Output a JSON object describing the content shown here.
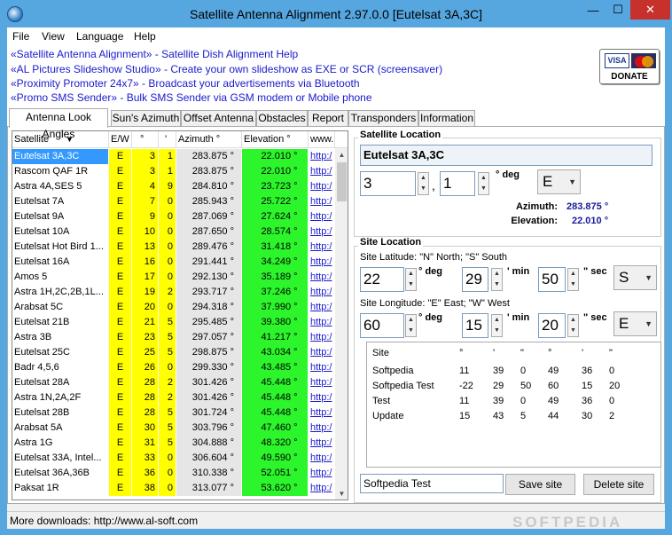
{
  "window": {
    "title": "Satellite Antenna Alignment 2.97.0.0 [Eutelsat 3A,3C]",
    "min_label": "—",
    "max_label": "☐",
    "close_label": "✕"
  },
  "menu": [
    "File",
    "View",
    "Language",
    "Help"
  ],
  "promo_links": [
    "«Satellite Antenna Alignment» - Satellite Dish Alignment Help",
    "«AL Pictures Slideshow Studio» - Create your own slideshow as EXE or SCR (screensaver)",
    "«Proximity Promoter 24x7» - Broadcast your advertisements via Bluetooth",
    "«Promo SMS Sender» - Bulk SMS Sender via GSM modem or Mobile phone"
  ],
  "donate": {
    "label": "DONATE",
    "visa": "VISA"
  },
  "tabs": [
    "Antenna Look Angles",
    "Sun's Azimuth",
    "Offset Antenna",
    "Obstacles",
    "Report",
    "Transponders",
    "Information"
  ],
  "grid": {
    "headers": [
      "Satellite",
      "E/W",
      "°",
      "'",
      "Azimuth °",
      "Elevation °",
      "www."
    ],
    "rows": [
      {
        "name": "Eutelsat 3A,3C",
        "ew": "E",
        "deg": "3",
        "min": "1",
        "az": "283.875 °",
        "el": "22.010 °",
        "url": "http:/"
      },
      {
        "name": "Rascom QAF 1R",
        "ew": "E",
        "deg": "3",
        "min": "1",
        "az": "283.875 °",
        "el": "22.010 °",
        "url": "http:/"
      },
      {
        "name": "Astra 4A,SES 5",
        "ew": "E",
        "deg": "4",
        "min": "9",
        "az": "284.810 °",
        "el": "23.723 °",
        "url": "http:/"
      },
      {
        "name": "Eutelsat 7A",
        "ew": "E",
        "deg": "7",
        "min": "0",
        "az": "285.943 °",
        "el": "25.722 °",
        "url": "http:/"
      },
      {
        "name": "Eutelsat 9A",
        "ew": "E",
        "deg": "9",
        "min": "0",
        "az": "287.069 °",
        "el": "27.624 °",
        "url": "http:/"
      },
      {
        "name": "Eutelsat 10A",
        "ew": "E",
        "deg": "10",
        "min": "0",
        "az": "287.650 °",
        "el": "28.574 °",
        "url": "http:/"
      },
      {
        "name": "Eutelsat Hot Bird 1...",
        "ew": "E",
        "deg": "13",
        "min": "0",
        "az": "289.476 °",
        "el": "31.418 °",
        "url": "http:/"
      },
      {
        "name": "Eutelsat 16A",
        "ew": "E",
        "deg": "16",
        "min": "0",
        "az": "291.441 °",
        "el": "34.249 °",
        "url": "http:/"
      },
      {
        "name": "Amos 5",
        "ew": "E",
        "deg": "17",
        "min": "0",
        "az": "292.130 °",
        "el": "35.189 °",
        "url": "http:/"
      },
      {
        "name": "Astra 1H,2C,2B,1L...",
        "ew": "E",
        "deg": "19",
        "min": "2",
        "az": "293.717 °",
        "el": "37.246 °",
        "url": "http:/"
      },
      {
        "name": "Arabsat 5C",
        "ew": "E",
        "deg": "20",
        "min": "0",
        "az": "294.318 °",
        "el": "37.990 °",
        "url": "http:/"
      },
      {
        "name": "Eutelsat 21B",
        "ew": "E",
        "deg": "21",
        "min": "5",
        "az": "295.485 °",
        "el": "39.380 °",
        "url": "http:/"
      },
      {
        "name": "Astra 3B",
        "ew": "E",
        "deg": "23",
        "min": "5",
        "az": "297.057 °",
        "el": "41.217 °",
        "url": "http:/"
      },
      {
        "name": "Eutelsat 25C",
        "ew": "E",
        "deg": "25",
        "min": "5",
        "az": "298.875 °",
        "el": "43.034 °",
        "url": "http:/"
      },
      {
        "name": "Badr 4,5,6",
        "ew": "E",
        "deg": "26",
        "min": "0",
        "az": "299.330 °",
        "el": "43.485 °",
        "url": "http:/"
      },
      {
        "name": "Eutelsat 28A",
        "ew": "E",
        "deg": "28",
        "min": "2",
        "az": "301.426 °",
        "el": "45.448 °",
        "url": "http:/"
      },
      {
        "name": "Astra 1N,2A,2F",
        "ew": "E",
        "deg": "28",
        "min": "2",
        "az": "301.426 °",
        "el": "45.448 °",
        "url": "http:/"
      },
      {
        "name": "Eutelsat 28B",
        "ew": "E",
        "deg": "28",
        "min": "5",
        "az": "301.724 °",
        "el": "45.448 °",
        "url": "http:/"
      },
      {
        "name": "Arabsat 5A",
        "ew": "E",
        "deg": "30",
        "min": "5",
        "az": "303.796 °",
        "el": "47.460 °",
        "url": "http:/"
      },
      {
        "name": "Astra 1G",
        "ew": "E",
        "deg": "31",
        "min": "5",
        "az": "304.888 °",
        "el": "48.320 °",
        "url": "http:/"
      },
      {
        "name": "Eutelsat 33A, Intel...",
        "ew": "E",
        "deg": "33",
        "min": "0",
        "az": "306.604 °",
        "el": "49.590 °",
        "url": "http:/"
      },
      {
        "name": "Eutelsat 36A,36B",
        "ew": "E",
        "deg": "36",
        "min": "0",
        "az": "310.338 °",
        "el": "52.051 °",
        "url": "http:/"
      },
      {
        "name": "Paksat 1R",
        "ew": "E",
        "deg": "38",
        "min": "0",
        "az": "313.077 °",
        "el": "53.620 °",
        "url": "http:/"
      }
    ]
  },
  "satellite_location": {
    "group_label": "Satellite Location",
    "name": "Eutelsat 3A,3C",
    "deg": "3",
    "min": "1",
    "deg_unit": "° deg",
    "dir": "E",
    "azimuth_label": "Azimuth:",
    "azimuth_value": "283.875 °",
    "elevation_label": "Elevation:",
    "elevation_value": "22.010 °"
  },
  "site_location": {
    "group_label": "Site Location",
    "lat_label": "Site Latitude:  \"N\" North;  \"S\" South",
    "lat_deg": "22",
    "lat_min": "29",
    "lat_sec": "50",
    "lat_dir": "S",
    "lon_label": "Site Longitude:  \"E\" East;  \"W\" West",
    "lon_deg": "60",
    "lon_min": "15",
    "lon_sec": "20",
    "lon_dir": "E",
    "deg_unit": "° deg",
    "min_unit": "' min",
    "sec_unit": "\" sec",
    "list_headers": [
      "Site",
      "°",
      "'",
      "\"",
      "°",
      "'",
      "\""
    ],
    "sites": [
      [
        "Softpedia",
        "11",
        "39",
        "0",
        "49",
        "36",
        "0"
      ],
      [
        "Softpedia Test",
        "-22",
        "29",
        "50",
        "60",
        "15",
        "20"
      ],
      [
        "Test",
        "11",
        "39",
        "0",
        "49",
        "36",
        "0"
      ],
      [
        "Update",
        "15",
        "43",
        "5",
        "44",
        "30",
        "2"
      ]
    ],
    "site_name_value": "Softpedia Test",
    "save_label": "Save site",
    "delete_label": "Delete site"
  },
  "status": "More downloads: http://www.al-soft.com",
  "watermark": "SOFTPEDIA"
}
